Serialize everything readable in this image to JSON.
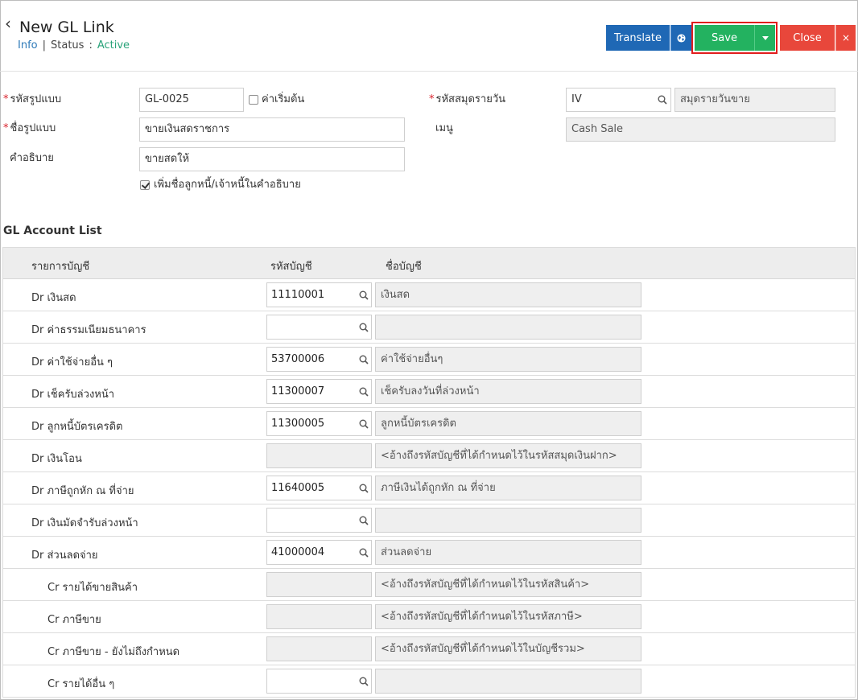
{
  "header": {
    "back_glyph": "‹",
    "title": "New GL Link",
    "info_label": "Info",
    "separator": "|",
    "status_label": "Status",
    "status_colon": ":",
    "status_value": "Active"
  },
  "toolbar": {
    "translate_label": "Translate",
    "globe_icon": "globe-icon",
    "save_label": "Save",
    "close_label": "Close",
    "close_x": "×",
    "colors": {
      "translate": "#1f68b5",
      "save": "#23b260",
      "close": "#e8473b",
      "highlight": "#e21d1d"
    }
  },
  "form": {
    "code_label": "รหัสรูปแบบ",
    "code_value": "GL-0025",
    "default_label": "ค่าเริ่มต้น",
    "name_label": "ชื่อรูปแบบ",
    "name_value": "ขายเงินสดราชการ",
    "desc_label": "คำอธิบาย",
    "desc_value": "ขายสดให้",
    "add_name_label": "เพิ่มชื่อลูกหนี้/เจ้าหนี้ในคำอธิบาย",
    "journal_label": "รหัสสมุดรายวัน",
    "journal_value": "IV",
    "journal_name": "สมุดรายวันขาย",
    "menu_label": "เมนู",
    "menu_value": "Cash Sale",
    "required_mark": "*"
  },
  "gl_list": {
    "title": "GL Account List",
    "col_item": "รายการบัญชี",
    "col_code": "รหัสบัญชี",
    "col_name": "ชื่อบัญชี",
    "rows": [
      {
        "label": "Dr เงินสด",
        "code": "11110001",
        "name": "เงินสด"
      },
      {
        "label": "Dr ค่าธรรมเนียมธนาคาร",
        "code": "",
        "name": ""
      },
      {
        "label": "Dr ค่าใช้จ่ายอื่น ๆ",
        "code": "53700006",
        "name": "ค่าใช้จ่ายอื่นๆ"
      },
      {
        "label": "Dr เช็ครับล่วงหน้า",
        "code": "11300007",
        "name": "เช็ครับลงวันที่ล่วงหน้า"
      },
      {
        "label": "Dr ลูกหนี้บัตรเครดิต",
        "code": "11300005",
        "name": "ลูกหนี้บัตรเครดิต"
      },
      {
        "label": "Dr เงินโอน",
        "code": "",
        "name": "<อ้างถึงรหัสบัญชีที่ได้กำหนดไว้ในรหัสสมุดเงินฝาก>"
      },
      {
        "label": "Dr ภาษีถูกหัก ณ ที่จ่าย",
        "code": "11640005",
        "name": "ภาษีเงินได้ถูกหัก ณ ที่จ่าย"
      },
      {
        "label": "Dr เงินมัดจำรับล่วงหน้า",
        "code": "",
        "name": ""
      },
      {
        "label": "Dr ส่วนลดจ่าย",
        "code": "41000004",
        "name": "ส่วนลดจ่าย"
      },
      {
        "label": "Cr รายได้ขายสินค้า",
        "code": "",
        "name": "<อ้างถึงรหัสบัญชีที่ได้กำหนดไว้ในรหัสสินค้า>"
      },
      {
        "label": "Cr ภาษีขาย",
        "code": "",
        "name": "<อ้างถึงรหัสบัญชีที่ได้กำหนดไว้ในรหัสภาษี>"
      },
      {
        "label": "Cr ภาษีขาย - ยังไม่ถึงกำหนด",
        "code": "",
        "name": "<อ้างถึงรหัสบัญชีที่ได้กำหนดไว้ในบัญชีรวม>"
      },
      {
        "label": "Cr รายได้อื่น ๆ",
        "code": "",
        "name": ""
      }
    ]
  }
}
